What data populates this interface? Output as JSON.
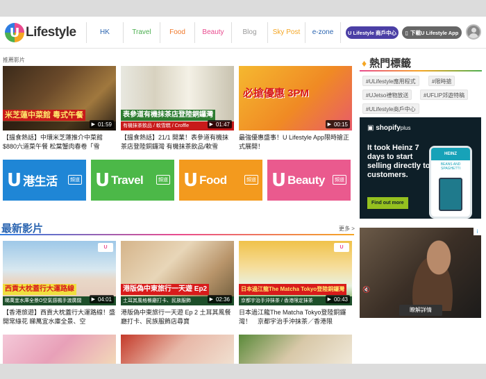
{
  "header": {
    "logo_text": "Lifestyle",
    "logo_badge": "U",
    "nav": [
      {
        "label": "HK",
        "color": "#2a64b0"
      },
      {
        "label": "Travel",
        "color": "#4caf50"
      },
      {
        "label": "Food",
        "color": "#f0782a"
      },
      {
        "label": "Beauty",
        "color": "#e94b8f"
      },
      {
        "label": "Blog",
        "color": "#999999"
      },
      {
        "label": "Sky Post",
        "color": "#f5a623"
      },
      {
        "label": "e-zone",
        "color": "#2a64b0"
      }
    ],
    "merchant_button": "U Lifestyle 商戶中心",
    "download_button": "下載U Lifestyle App"
  },
  "featured": {
    "section_label": "推薦影片",
    "items": [
      {
        "thumb_text": "米芝蓮中菜館 粵式午餐",
        "duration": "01:59",
        "desc": "【搵食熱話】中環米芝蓮推介中菜館 $880六道菜午餐 松葉蟹肉春卷「雪"
      },
      {
        "thumb_text": "表參道有機抹茶店登陸銅鑼灣",
        "thumb_sub": "有機抹茶飲品 / 軟雪糕 / Croffle",
        "duration": "01:47",
        "desc": "【搵食熱話】21/1 開業！表參道有機抹茶店登陸銅鑼灣 有機抹茶飲品/軟雪"
      },
      {
        "thumb_text": "必搶優惠 3PM",
        "duration": "00:15",
        "desc": "最強優惠盛事！U Lifestyle App限時搶正式展開！"
      }
    ]
  },
  "channels": [
    {
      "badge": "U",
      "name": "港生活",
      "tag": "頻道",
      "color": "#1f86d6"
    },
    {
      "badge": "U",
      "name": "Travel",
      "tag": "頻道",
      "color": "#4cb848"
    },
    {
      "badge": "U",
      "name": "Food",
      "tag": "頻道",
      "color": "#f39a1e"
    },
    {
      "badge": "U",
      "name": "Beauty",
      "tag": "頻道",
      "color": "#ea5a8e"
    }
  ],
  "latest": {
    "title": "最新影片",
    "more": "更多 >",
    "items": [
      {
        "thumb_text": "西貢大枕蓋行大運路線",
        "thumb_sub": "睇萬宜水庫全景O空氣感楓手渡廣闊",
        "duration": "04:01",
        "desc": "【香港旅遊】西貢大枕蓋行大運路線！盛開常綠花 睇萬宜水庫全景、空"
      },
      {
        "thumb_text": "港版偽中東旅行一天遊 Ep2",
        "thumb_sub": "土耳其風格餐廳打卡、民族服飾",
        "duration": "02:36",
        "desc": "港版偽中東旅行一天遊 Ep 2 土耳其風餐廳打卡、民族服飾店尋寶"
      },
      {
        "thumb_text": "日本過江龍The Matcha Tokyo登陸銅鑼灣",
        "thumb_sub": "京都宇治手沖抹茶 / 香港限定抹茶",
        "duration": "00:43",
        "desc": "日本過江龍The Matcha Tokyo登陸銅鑼灣！　京都宇治手沖抹茶／香港限"
      }
    ]
  },
  "sidebar": {
    "tags_title": "熱門標籤",
    "tags": [
      "#ULifestyle應用程式",
      "#限時搶",
      "#UJetso禮物放送",
      "#UFLIP郊遊特稿",
      "#ULifestyle商戶中心"
    ],
    "ad1": {
      "brand": "shopify",
      "brand_suffix": "plus",
      "headline": "It took Heinz 7 days to start selling directly to customers.",
      "cta": "Find out more",
      "phone_text": "HEINZ",
      "phone_sub": "BEANS AND SPAGHETTI"
    },
    "ad2": {
      "cta": "瞭解詳情",
      "ad_marker": "i"
    }
  }
}
